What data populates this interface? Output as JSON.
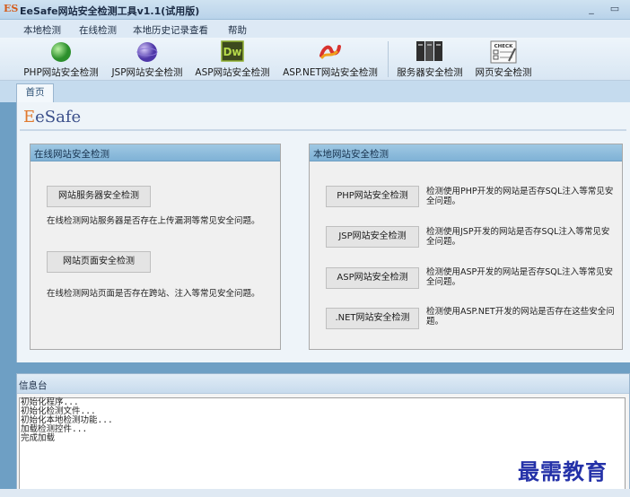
{
  "window": {
    "logo": "ES",
    "title": "EeSafe网站安全检测工具v1.1(试用版)",
    "minimize": "_",
    "maximize": "▭"
  },
  "menu": [
    "本地检测",
    "在线检测",
    "本地历史记录查看",
    "帮助"
  ],
  "toolbar": [
    {
      "label": "PHP网站安全检测",
      "icon": "php-globe-icon",
      "color": "#38a838"
    },
    {
      "label": "JSP网站安全检测",
      "icon": "jsp-globe-icon",
      "color": "#6a4fc0"
    },
    {
      "label": "ASP网站安全检测",
      "icon": "dreamweaver-icon",
      "color": "#6b8e23",
      "icon_text": "Dw"
    },
    {
      "label": "ASP.NET网站安全检测",
      "icon": "aspnet-icon",
      "color": "#d8322e"
    },
    {
      "label": "服务器安全检测",
      "icon": "server-icon",
      "color": "#3a3a3a"
    },
    {
      "label": "网页安全检测",
      "icon": "webpage-check-icon",
      "color": "#555555",
      "icon_text": "CHECK"
    }
  ],
  "tabs": [
    "首页"
  ],
  "brand": {
    "first": "E",
    "rest": "eSafe"
  },
  "online_panel": {
    "title": "在线网站安全检测",
    "server_button": "网站服务器安全检测",
    "server_desc": "在线检测网站服务器是否存在上传漏洞等常见安全问题。",
    "page_button": "网站页面安全检测",
    "page_desc": "在线检测网站页面是否存在跨站、注入等常见安全问题。"
  },
  "local_panel": {
    "title": "本地网站安全检测",
    "items": [
      {
        "button": "PHP网站安全检测",
        "desc": "检测使用PHP开发的网站是否存SQL注入等常见安全问题。"
      },
      {
        "button": "JSP网站安全检测",
        "desc": "检测使用JSP开发的网站是否存SQL注入等常见安全问题。"
      },
      {
        "button": "ASP网站安全检测",
        "desc": "检测使用ASP开发的网站是否存SQL注入等常见安全问题。"
      },
      {
        "button": ".NET网站安全检测",
        "desc": "检测使用ASP.NET开发的网站是否存在这些安全问题。"
      }
    ]
  },
  "info": {
    "title": "信息台",
    "log": [
      "初始化程序...",
      "初始化检测文件...",
      "初始化本地检测功能...",
      "加载检测控件...",
      "完成加载"
    ]
  },
  "watermark": "最需教育"
}
